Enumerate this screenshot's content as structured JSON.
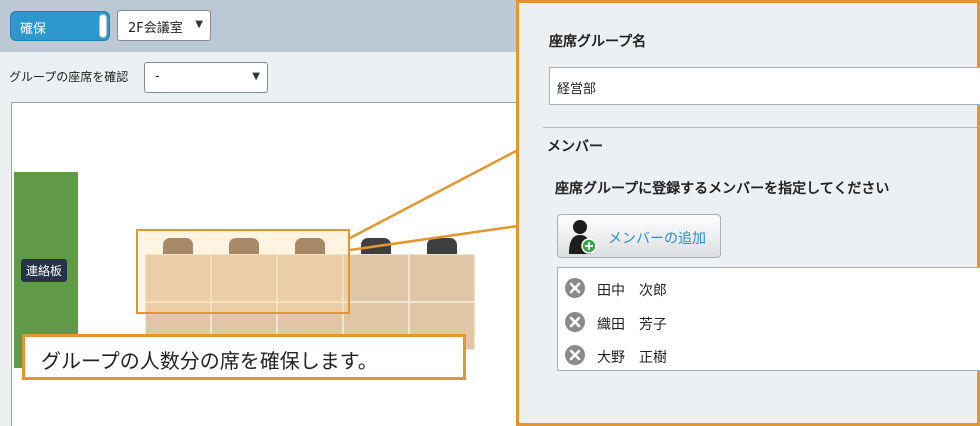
{
  "toolbar": {
    "reserve_toggle_label": "確保",
    "room_select_value": "2F会議室"
  },
  "filter": {
    "label": "グループの座席を確認",
    "group_select_value": "-"
  },
  "floor": {
    "board_label": "連絡板",
    "callout_text": "グループの人数分の席を確保します。"
  },
  "panel": {
    "seat_group_title": "座席グループ名",
    "seat_group_value": "経営部",
    "member_title": "メンバー",
    "member_desc": "座席グループに登録するメンバーを指定してください",
    "add_member_label": "メンバーの追加",
    "members": [
      {
        "name": "田中　次郎"
      },
      {
        "name": "織田　芳子"
      },
      {
        "name": "大野　正樹"
      }
    ]
  },
  "colors": {
    "accent_orange": "#e3962f",
    "toggle_blue": "#2e98cc",
    "board_green": "#5f9a46",
    "link_blue": "#2a8fc6"
  },
  "icons": {
    "add_member": "user-add-icon",
    "remove_member": "remove-circle-icon",
    "dropdown": "caret-down-icon"
  }
}
